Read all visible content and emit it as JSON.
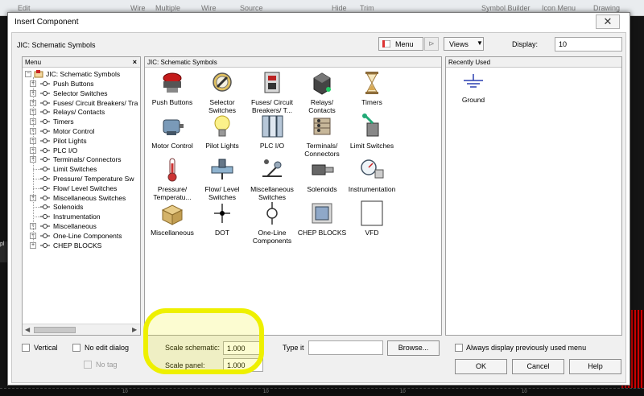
{
  "background_app": {
    "ribbon_labels": [
      "Edit",
      "Wire",
      "Multiple",
      "Wire",
      "Source",
      "Hide",
      "Trim",
      "Symbol Builder",
      "Icon Menu",
      "Drawing"
    ],
    "left_strip": "pl",
    "ruler_labels": [
      "10",
      "10",
      "10",
      "10"
    ]
  },
  "dialog": {
    "title": "Insert Component",
    "close_glyph": "✕",
    "header_title": "JIC: Schematic Symbols",
    "menu_button": "Menu",
    "views_button": "Views",
    "display_label": "Display:",
    "display_value": "10"
  },
  "menu_panel": {
    "header": "Menu",
    "close_glyph": "×",
    "root": "JIC: Schematic Symbols",
    "items": [
      {
        "label": "Push Buttons",
        "expandable": true
      },
      {
        "label": "Selector Switches",
        "expandable": true
      },
      {
        "label": "Fuses/ Circuit Breakers/ Tra",
        "expandable": true
      },
      {
        "label": "Relays/ Contacts",
        "expandable": true
      },
      {
        "label": "Timers",
        "expandable": true
      },
      {
        "label": "Motor Control",
        "expandable": true
      },
      {
        "label": "Pilot Lights",
        "expandable": true
      },
      {
        "label": "PLC I/O",
        "expandable": true
      },
      {
        "label": "Terminals/ Connectors",
        "expandable": true
      },
      {
        "label": "Limit Switches",
        "expandable": false
      },
      {
        "label": "Pressure/ Temperature Sw",
        "expandable": false
      },
      {
        "label": "Flow/ Level Switches",
        "expandable": false
      },
      {
        "label": "Miscellaneous Switches",
        "expandable": true
      },
      {
        "label": "Solenoids",
        "expandable": false
      },
      {
        "label": "Instrumentation",
        "expandable": false
      },
      {
        "label": "Miscellaneous",
        "expandable": true
      },
      {
        "label": "One-Line Components",
        "expandable": true
      },
      {
        "label": "CHEP BLOCKS",
        "expandable": true
      }
    ]
  },
  "symbols_panel": {
    "header": "JIC: Schematic Symbols",
    "items": [
      {
        "label": "Push Buttons",
        "icon": "push-button-icon"
      },
      {
        "label": "Selector Switches",
        "icon": "selector-switch-icon"
      },
      {
        "label": "Fuses/ Circuit Breakers/ T...",
        "icon": "circuit-breaker-icon"
      },
      {
        "label": "Relays/ Contacts",
        "icon": "relay-icon"
      },
      {
        "label": "Timers",
        "icon": "hourglass-icon"
      },
      {
        "label": "Motor Control",
        "icon": "motor-icon"
      },
      {
        "label": "Pilot Lights",
        "icon": "light-bulb-icon"
      },
      {
        "label": "PLC I/O",
        "icon": "plc-icon"
      },
      {
        "label": "Terminals/ Connectors",
        "icon": "terminal-icon"
      },
      {
        "label": "Limit Switches",
        "icon": "limit-switch-icon"
      },
      {
        "label": "Pressure/ Temperatu...",
        "icon": "thermometer-icon"
      },
      {
        "label": "Flow/ Level Switches",
        "icon": "flow-switch-icon"
      },
      {
        "label": "Miscellaneous Switches",
        "icon": "misc-switch-icon"
      },
      {
        "label": "Solenoids",
        "icon": "solenoid-icon"
      },
      {
        "label": "Instrumentation",
        "icon": "gauge-icon"
      },
      {
        "label": "Miscellaneous",
        "icon": "box-icon"
      },
      {
        "label": "DOT",
        "icon": "dot-icon"
      },
      {
        "label": "One-Line Components",
        "icon": "one-line-icon"
      },
      {
        "label": "CHEP BLOCKS",
        "icon": "chep-blocks-icon"
      },
      {
        "label": "VFD",
        "icon": "vfd-icon"
      }
    ]
  },
  "recent_panel": {
    "header": "Recently Used",
    "items": [
      {
        "label": "Ground",
        "icon": "ground-icon"
      }
    ]
  },
  "footer": {
    "vertical_label": "Vertical",
    "no_edit_dialog_label": "No edit dialog",
    "no_tag_label": "No tag",
    "scale_schematic_label": "Scale schematic:",
    "scale_schematic_value": "1.000",
    "scale_panel_label": "Scale panel:",
    "scale_panel_value": "1.000",
    "type_it_label": "Type it",
    "type_it_value": "",
    "browse_button": "Browse...",
    "always_display_label": "Always display previously used menu",
    "ok_button": "OK",
    "cancel_button": "Cancel",
    "help_button": "Help"
  },
  "colors": {
    "highlight": "#eef000",
    "red_accent": "#cc1111"
  }
}
